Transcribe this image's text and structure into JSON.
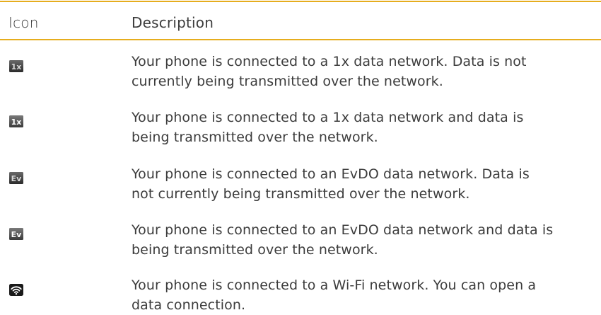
{
  "table": {
    "header": {
      "icon_label": "Icon",
      "description_label": "Description"
    },
    "rows": [
      {
        "icon": "1x-data-icon",
        "icon_text": "1x",
        "description": "Your phone is connected to a 1x data network. Data is not currently being transmitted over the network."
      },
      {
        "icon": "1x-data-active-icon",
        "icon_text": "1x",
        "description": "Your phone is connected to a 1x data network and data is being transmitted over the network."
      },
      {
        "icon": "evdo-data-icon",
        "icon_text": "Ev",
        "description": "Your phone is connected to an EvDO data network. Data is not currently being transmitted over the network."
      },
      {
        "icon": "evdo-data-active-icon",
        "icon_text": "Ev",
        "description": "Your phone is connected to an EvDO data network and data is being transmitted over the network."
      },
      {
        "icon": "wifi-icon",
        "icon_text": "",
        "description": "Your phone is connected to a Wi-Fi network. You can open a data connection."
      }
    ]
  },
  "colors": {
    "rule": "#e6ad1e",
    "text": "#3c3c3c"
  }
}
